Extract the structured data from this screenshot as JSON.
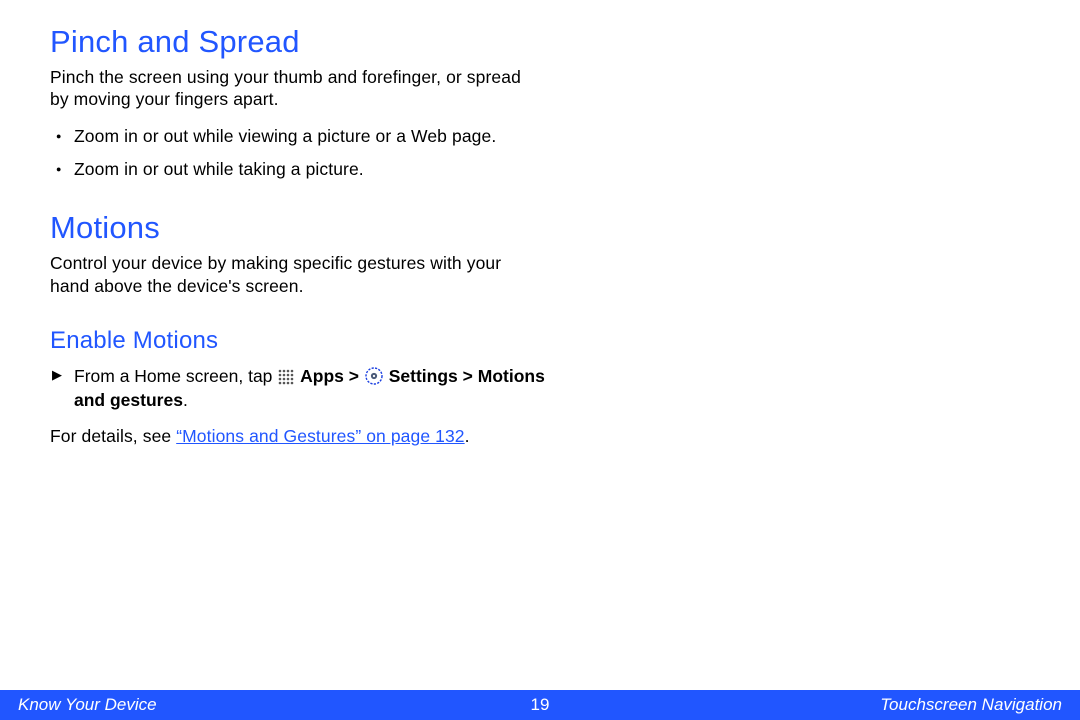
{
  "colors": {
    "accent": "#2156ff",
    "iconRing": "#1a3fe0"
  },
  "sections": {
    "pinch": {
      "heading": "Pinch and Spread",
      "intro": "Pinch the screen using your thumb and forefinger, or spread by moving your fingers apart.",
      "bullets": [
        "Zoom in or out while viewing a picture or a Web page.",
        "Zoom in or out while taking a picture."
      ]
    },
    "motions": {
      "heading": "Motions",
      "intro": "Control your device by making specific gestures with your hand above the device's screen."
    },
    "enable": {
      "heading": "Enable Motions",
      "step": {
        "prefix": "From a Home screen, tap ",
        "apps_label": "Apps",
        "gt1": " > ",
        "settings_label": "Settings",
        "gt2": " > ",
        "tail": "Motions and gestures",
        "period": "."
      },
      "details_prefix": "For details, see ",
      "details_link": "“Motions and Gestures” on page 132",
      "details_period": "."
    }
  },
  "footer": {
    "left": "Know Your Device",
    "page": "19",
    "right": "Touchscreen Navigation"
  }
}
